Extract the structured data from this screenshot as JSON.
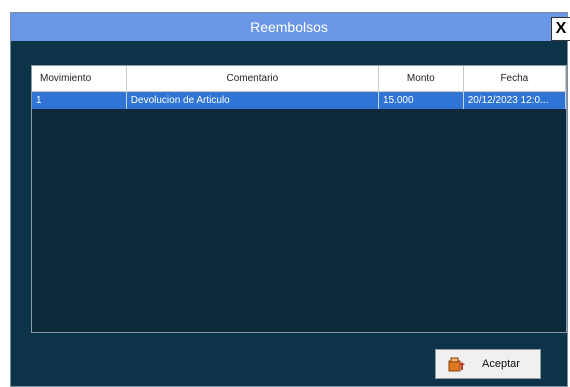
{
  "window": {
    "title": "Reembolsos",
    "close_label": "X"
  },
  "grid": {
    "columns": [
      "Movimiento",
      "Comentario",
      "Monto",
      "Fecha"
    ],
    "rows": [
      {
        "movimiento": "1",
        "comentario": "Devolucion de Articulo",
        "monto": "15.000",
        "fecha": "20/12/2023 12:0..."
      }
    ]
  },
  "footer": {
    "accept_label": "Aceptar",
    "accept_icon": "accept-icon"
  },
  "colors": {
    "titlebar": "#6b98e6",
    "window_bg": "#0c3347",
    "selected_row": "#3075d6"
  }
}
